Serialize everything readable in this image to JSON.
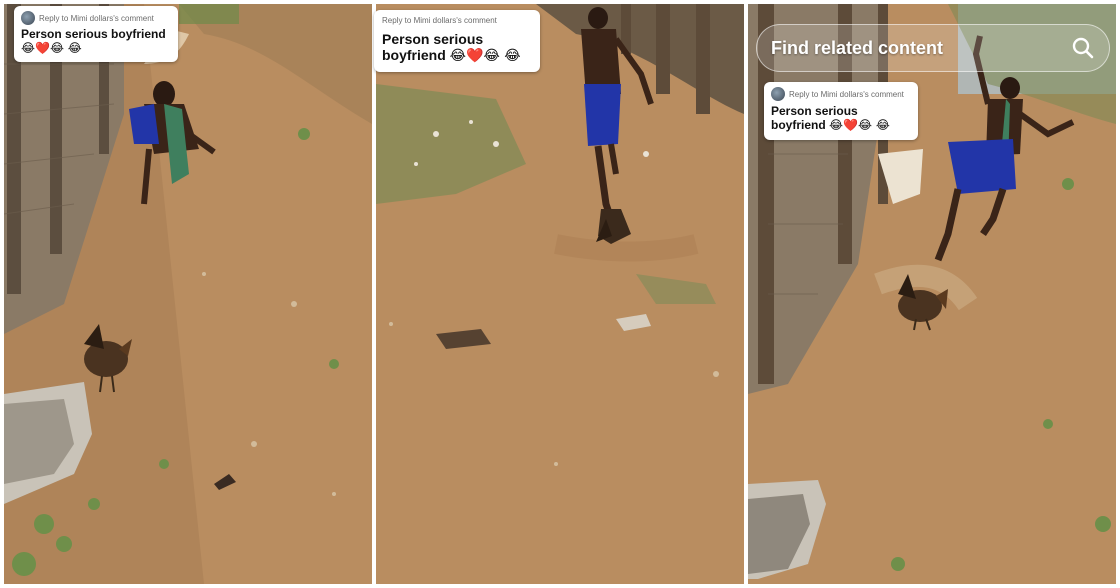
{
  "panels": [
    {
      "reply_label": "Reply to Mimi dollars's comment",
      "caption_text": "Person serious boyfriend",
      "caption_emojis": "😂❤️😂 😂"
    },
    {
      "reply_label": "Reply to Mimi dollars's comment",
      "caption_text": "Person serious boyfriend",
      "caption_emojis": "😂❤️😂 😂"
    },
    {
      "reply_label": "Reply to Mimi dollars's comment",
      "caption_text": "Person serious boyfriend",
      "caption_emojis": "😂❤️😂 😂"
    }
  ],
  "search": {
    "label": "Find related content",
    "icon": "search-icon"
  },
  "colors": {
    "ground": "#b98d60",
    "wall": "#8a7a66",
    "skin": "#3a2418",
    "shorts": "#2235a8",
    "towel": "#3f7f5e"
  }
}
